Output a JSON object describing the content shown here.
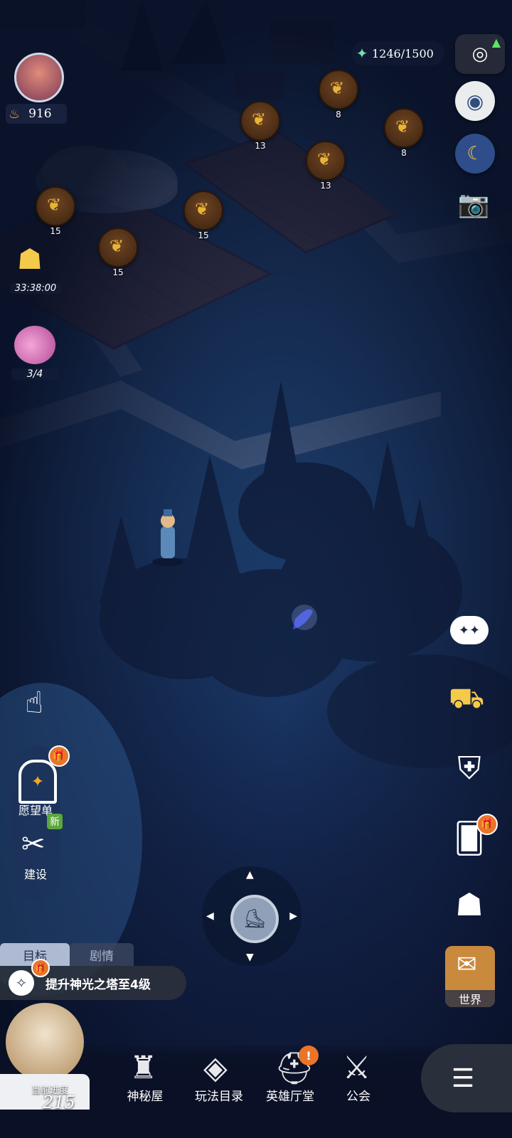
{
  "resources": {
    "energy": "1246/1500",
    "power": "916"
  },
  "timers": {
    "chest_timer": "33:38:00",
    "flower_progress": "3/4"
  },
  "crops": [
    {
      "value": "13"
    },
    {
      "value": "8"
    },
    {
      "value": "8"
    },
    {
      "value": "13"
    },
    {
      "value": "15"
    },
    {
      "value": "15"
    },
    {
      "value": "15"
    }
  ],
  "left_menu": {
    "wishlist_label": "愿望单",
    "build_label": "建设",
    "new_badge": "新"
  },
  "quest": {
    "tab_goal": "目标",
    "tab_story": "剧情",
    "text": "提升神光之塔至4级"
  },
  "progress": {
    "label": "当前进度",
    "value": "215"
  },
  "bottom_nav": {
    "items": [
      {
        "label": "神秘屋"
      },
      {
        "label": "玩法目录"
      },
      {
        "label": "英雄厅堂"
      },
      {
        "label": "公会"
      }
    ],
    "alert": "!"
  },
  "right_menu": {
    "world_label": "世界"
  },
  "colors": {
    "accent_orange": "#e8752a",
    "new_green": "#5aa83a",
    "crop_gold": "#e8b436"
  }
}
